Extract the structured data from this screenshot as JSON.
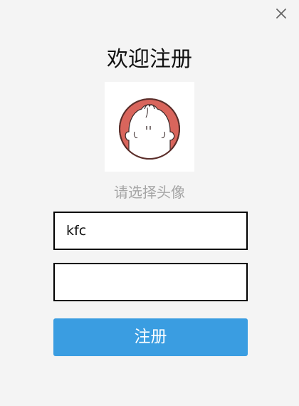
{
  "window": {
    "close_icon": "close-icon"
  },
  "title": "欢迎注册",
  "avatar": {
    "icon": "cartoon-face-avatar",
    "prompt": "请选择头像"
  },
  "form": {
    "username_value": "kfc",
    "username_placeholder": "",
    "password_value": "",
    "password_placeholder": ""
  },
  "register_label": "注册",
  "colors": {
    "background": "#f4f4f4",
    "accent": "#3a9de1",
    "avatar_ring": "#d9655c",
    "muted_text": "#a6a6a6"
  }
}
